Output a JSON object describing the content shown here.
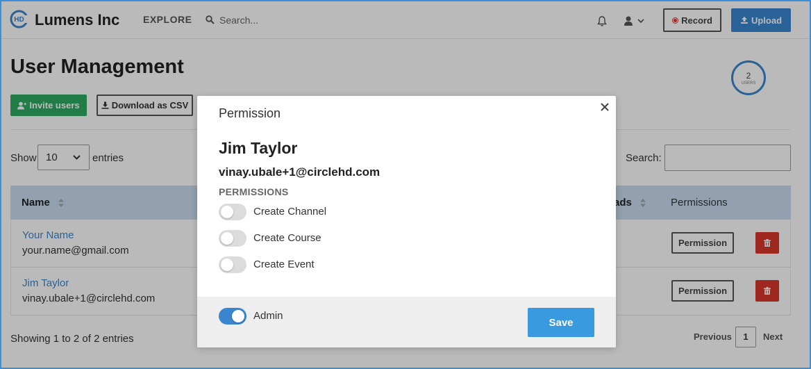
{
  "header": {
    "app_name": "Lumens Inc",
    "logo_text": "HD",
    "explore_label": "EXPLORE",
    "search_placeholder": "Search...",
    "record_label": "Record",
    "upload_label": "Upload",
    "accent_color": "#3a85cf"
  },
  "page": {
    "title": "User Management",
    "users_count": "2",
    "users_label": "USERS",
    "invite_label": "Invite users",
    "csv_label": "Download as CSV",
    "show_label": "Show",
    "entries_select_value": "10",
    "entries_label": "entries",
    "search_label": "Search:"
  },
  "table": {
    "columns": {
      "name": "Name",
      "uploads": "ads",
      "permissions": "Permissions"
    },
    "rows": [
      {
        "name": "Your Name",
        "email": "your.name@gmail.com",
        "permission_label": "Permission"
      },
      {
        "name": "Jim Taylor",
        "email": "vinay.ubale+1@circlehd.com",
        "permission_label": "Permission"
      }
    ],
    "footer": {
      "showing": "Showing 1 to 2 of 2 entries",
      "previous": "Previous",
      "page": "1",
      "next": "Next"
    }
  },
  "modal": {
    "title": "Permission",
    "user_name": "Jim Taylor",
    "user_email": "vinay.ubale+1@circlehd.com",
    "permissions_heading": "PERMISSIONS",
    "permissions": [
      {
        "label": "Create Channel",
        "enabled": false
      },
      {
        "label": "Create Course",
        "enabled": false
      },
      {
        "label": "Create Event",
        "enabled": false
      }
    ],
    "admin": {
      "label": "Admin",
      "enabled": true
    },
    "save_label": "Save",
    "save_color": "#3a9ae0",
    "toggle_on_color": "#3a85cf",
    "toggle_off_color": "#dcdcdc"
  }
}
